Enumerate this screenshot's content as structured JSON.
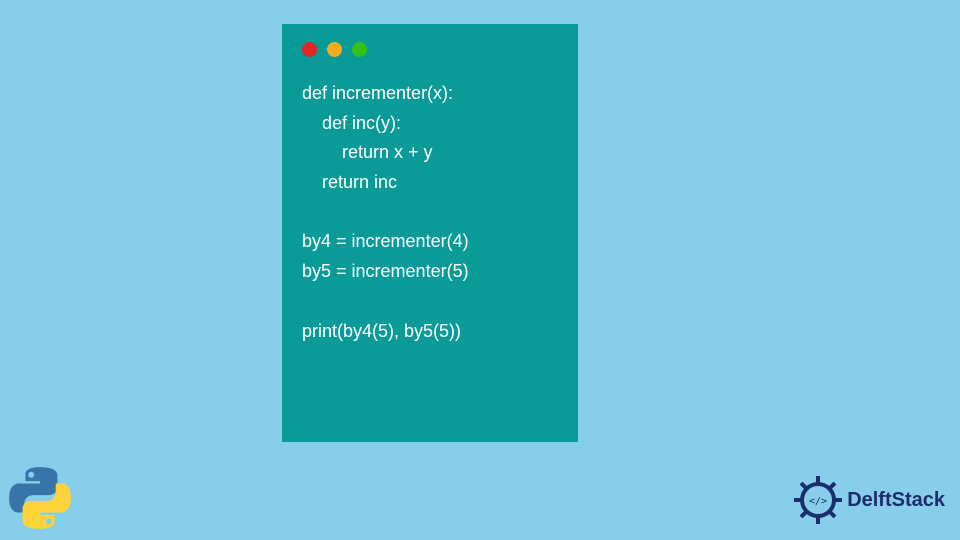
{
  "code": {
    "lines": [
      "def incrementer(x):",
      "    def inc(y):",
      "        return x + y",
      "    return inc",
      "",
      "by4 = incrementer(4)",
      "by5 = incrementer(5)",
      "",
      "print(by4(5), by5(5))"
    ]
  },
  "brand": {
    "name": "DelftStack"
  },
  "traffic_lights": {
    "red": "close-icon",
    "yellow": "minimize-icon",
    "green": "maximize-icon"
  }
}
